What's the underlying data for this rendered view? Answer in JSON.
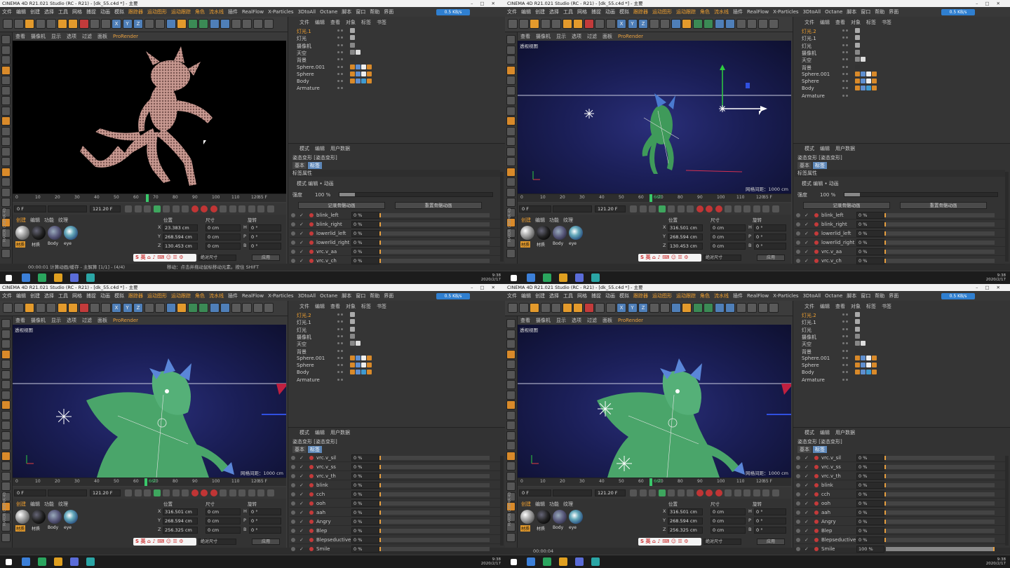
{
  "app": {
    "title": "CINEMA 4D R21.021 Studio (RC - R21) - [dk_55.c4d *] - 主要",
    "menus": [
      "文件",
      "编辑",
      "创建",
      "选择",
      "工具",
      "网格",
      "捕捉",
      "动画",
      "模拟",
      "跟踪器",
      "运动图形",
      "运动跟踪",
      "角色",
      "流水线",
      "插件",
      "RealFlow",
      "X-Particles",
      "3DtoAll",
      "Octane",
      "脚本",
      "窗口",
      "帮助"
    ],
    "menu_right": "界面",
    "net_meter": "0.5 KB/s",
    "toolbar_letters": [
      "X",
      "Y",
      "Z"
    ],
    "colors": {
      "accent": "#e39a2c",
      "selected_tab": "#5d87b8",
      "viewport_bg": "#1b1f58"
    }
  },
  "viewport_menu": [
    "查看",
    "摄像机",
    "显示",
    "选项",
    "过滤",
    "面板",
    "ProRender"
  ],
  "timeline": {
    "ticks": [
      "0",
      "10",
      "20",
      "30",
      "40",
      "50",
      "60",
      "70",
      "80",
      "90",
      "100",
      "110",
      "120"
    ],
    "end_label": "65 F"
  },
  "transport": {
    "current_frame": "0 F",
    "min_field": "0 F",
    "end_field": "121.20 F"
  },
  "material_panel": {
    "tabs": [
      "创建",
      "编辑",
      "功能",
      "纹理"
    ],
    "materials": [
      "材质",
      "材质",
      "Body",
      "eye"
    ]
  },
  "coord_panel": {
    "headers": [
      "位置",
      "尺寸",
      "旋转"
    ],
    "axes": [
      "X",
      "Y",
      "Z"
    ],
    "size_vals": [
      "0 cm",
      "0 cm",
      "0 cm"
    ],
    "rot_labels": [
      "H",
      "P",
      "B"
    ],
    "rot_vals": [
      "0 °",
      "0 °",
      "0 °"
    ],
    "mode": "绝对尺寸",
    "apply": "应用"
  },
  "object_manager": {
    "menu": [
      "文件",
      "编辑",
      "查看",
      "对象",
      "标签",
      "书签"
    ],
    "tags": "标签"
  },
  "attributes": {
    "menu": [
      "模式",
      "编辑",
      "用户数据"
    ],
    "title": "姿态变形 [姿态变形]",
    "tabs": [
      "基本",
      "标签"
    ],
    "section": "标签属性",
    "mode_row": "模式  编辑  •  动画",
    "strength_label": "强度",
    "strength_value": "100 %",
    "btn_record": "记录骨骼动画",
    "btn_reset": "重置骨骼动画"
  },
  "panes": [
    {
      "vp_label": "",
      "objects": [
        "灯光.1",
        "灯光",
        "摄像机",
        "天空",
        "背景",
        "Sphere.001",
        "Sphere",
        "Body",
        "Armature"
      ],
      "frame": "65 F",
      "grid_dist": "",
      "coords": {
        "x": "23.383 cm",
        "y": "268.594 cm",
        "z": "130.453 cm"
      },
      "morphs": [
        {
          "name": "blink_left",
          "val": "0 %",
          "fill": 0
        },
        {
          "name": "blink_right",
          "val": "0 %",
          "fill": 0
        },
        {
          "name": "lowerlid_left",
          "val": "0 %",
          "fill": 0
        },
        {
          "name": "lowerlid_right",
          "val": "0 %",
          "fill": 0
        },
        {
          "name": "vrc.v_aa",
          "val": "0 %",
          "fill": 0
        },
        {
          "name": "vrc.v_ch",
          "val": "0 %",
          "fill": 0
        }
      ],
      "status": "00:00:01 计算动画/缓存 - 主解算 [1/1] - (4/4)",
      "status_right": "移动：点击并拖动鼠标移动元素。按住 SHIFT",
      "render": true
    },
    {
      "vp_label": "透视视图",
      "objects": [
        "灯光.2",
        "灯光.1",
        "灯光",
        "摄像机",
        "天空",
        "背景",
        "Sphere.001",
        "Sphere",
        "Body",
        "Armature"
      ],
      "frame": "660",
      "grid_dist": "网格间距：1000 cm",
      "coords": {
        "x": "316.501 cm",
        "y": "268.594 cm",
        "z": "130.453 cm"
      },
      "morphs": [
        {
          "name": "blink_left",
          "val": "0 %",
          "fill": 0
        },
        {
          "name": "blink_right",
          "val": "0 %",
          "fill": 0
        },
        {
          "name": "lowerlid_left",
          "val": "0 %",
          "fill": 0
        },
        {
          "name": "lowerlid_right",
          "val": "0 %",
          "fill": 0
        },
        {
          "name": "vrc.v_aa",
          "val": "0 %",
          "fill": 0
        },
        {
          "name": "vrc.v_ch",
          "val": "0 %",
          "fill": 0
        }
      ],
      "status": "",
      "status_right": "",
      "render": false
    },
    {
      "vp_label": "透视视图",
      "objects": [
        "灯光.2",
        "灯光.1",
        "灯光",
        "摄像机",
        "天空",
        "背景",
        "Sphere.001",
        "Sphere",
        "Body",
        "Armature"
      ],
      "frame": "660",
      "grid_dist": "网格间距：1000 cm",
      "coords": {
        "x": "316.501 cm",
        "y": "268.594 cm",
        "z": "256.325 cm"
      },
      "morphs": [
        {
          "name": "vrc.v_sil",
          "val": "0 %",
          "fill": 0
        },
        {
          "name": "vrc.v_ss",
          "val": "0 %",
          "fill": 0
        },
        {
          "name": "vrc.v_th",
          "val": "0 %",
          "fill": 0
        },
        {
          "name": "blink",
          "val": "0 %",
          "fill": 0
        },
        {
          "name": "cch",
          "val": "0 %",
          "fill": 0
        },
        {
          "name": "ooh",
          "val": "0 %",
          "fill": 0
        },
        {
          "name": "aah",
          "val": "0 %",
          "fill": 0
        },
        {
          "name": "Angry",
          "val": "0 %",
          "fill": 0
        },
        {
          "name": "Blep",
          "val": "0 %",
          "fill": 0
        },
        {
          "name": "Blepseductive",
          "val": "0 %",
          "fill": 0
        },
        {
          "name": "Smile",
          "val": "0 %",
          "fill": 0
        }
      ],
      "status": "",
      "status_right": "",
      "render": false
    },
    {
      "vp_label": "透视视图",
      "objects": [
        "灯光.2",
        "灯光.1",
        "灯光",
        "摄像机",
        "天空",
        "背景",
        "Sphere.001",
        "Sphere",
        "Body",
        "Armature"
      ],
      "frame": "660",
      "grid_dist": "网格间距：1000 cm",
      "coords": {
        "x": "316.501 cm",
        "y": "268.594 cm",
        "z": "256.325 cm"
      },
      "morphs": [
        {
          "name": "vrc.v_sil",
          "val": "0 %",
          "fill": 0
        },
        {
          "name": "vrc.v_ss",
          "val": "0 %",
          "fill": 0
        },
        {
          "name": "vrc.v_th",
          "val": "0 %",
          "fill": 0
        },
        {
          "name": "blink",
          "val": "0 %",
          "fill": 0
        },
        {
          "name": "cch",
          "val": "0 %",
          "fill": 0
        },
        {
          "name": "ooh",
          "val": "0 %",
          "fill": 0
        },
        {
          "name": "aah",
          "val": "0 %",
          "fill": 0
        },
        {
          "name": "Angry",
          "val": "0 %",
          "fill": 0
        },
        {
          "name": "Blep",
          "val": "0 %",
          "fill": 0
        },
        {
          "name": "Blepseductive",
          "val": "0 %",
          "fill": 0
        },
        {
          "name": "Smile",
          "val": "100 %",
          "fill": 1
        }
      ],
      "status": "00:00:04",
      "status_right": "",
      "render": false
    }
  ],
  "ime_text": "S 英 ⌂ ♪ ⌨ ☺ ☰ ⚙",
  "brand": "MAXON CINEMA 4D",
  "taskbar": {
    "time": "9:38",
    "date": "2020/2/17"
  }
}
